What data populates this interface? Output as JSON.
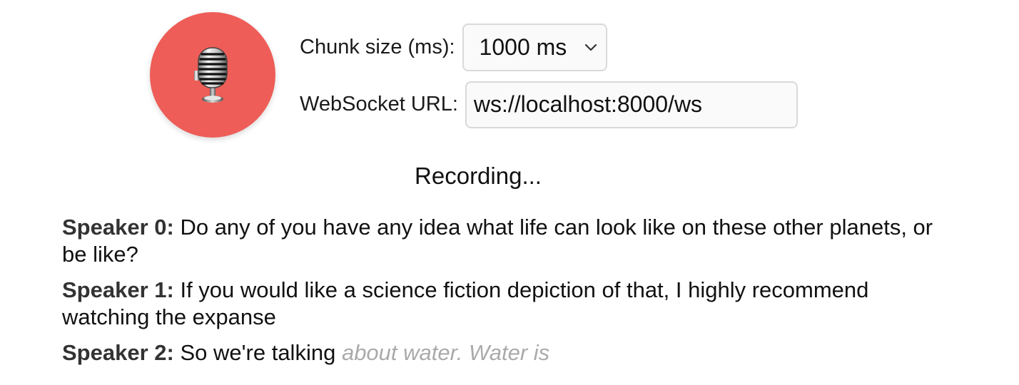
{
  "controls": {
    "chunk_label": "Chunk size (ms):",
    "chunk_value": "1000 ms",
    "ws_label": "WebSocket URL:",
    "ws_value": "ws://localhost:8000/ws",
    "record_icon": "microphone-icon",
    "record_color": "#ee5d57"
  },
  "status": "Recording...",
  "transcript": [
    {
      "speaker": "Speaker 0:",
      "text": "Do any of you have any idea what life can look like on these other planets, or be like?",
      "pending": ""
    },
    {
      "speaker": "Speaker 1:",
      "text": "If you would like a science fiction depiction of that, I highly recommend watching the expanse",
      "pending": ""
    },
    {
      "speaker": "Speaker 2:",
      "text": "So we're talking",
      "pending": "about water. Water is"
    }
  ]
}
